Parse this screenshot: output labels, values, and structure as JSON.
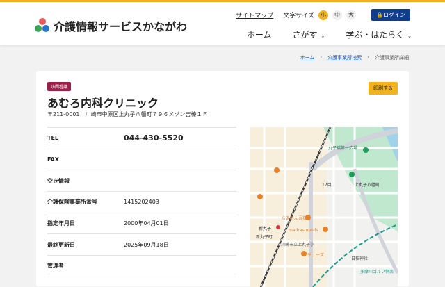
{
  "header": {
    "site_title": "介護情報サービスかながわ",
    "sitemap": "サイトマップ",
    "font_size_label": "文字サイズ",
    "sizes": [
      "小",
      "中",
      "大"
    ],
    "login": "ログイン"
  },
  "nav": [
    "ホーム",
    "さがす",
    "学ぶ・はたらく"
  ],
  "breadcrumb": [
    "ホーム",
    "介護事業所検索",
    "介護事業所詳細"
  ],
  "facility": {
    "category": "訪問看護",
    "name": "あむろ内科クリニック",
    "address": "〒211-0001　川崎市中原区上丸子八幡町７９６メゾン吉榛１Ｆ",
    "print": "印刷する"
  },
  "details": [
    {
      "label": "TEL",
      "value": "044-430-5520"
    },
    {
      "label": "FAX",
      "value": ""
    },
    {
      "label": "空き情報",
      "value": ""
    },
    {
      "label": "介護保険事業所番号",
      "value": "1415202403"
    },
    {
      "label": "指定年月日",
      "value": "2000年04月01日"
    },
    {
      "label": "最終更新日",
      "value": "2025年09月18日"
    },
    {
      "label": "管理者",
      "value": ""
    }
  ],
  "map": {
    "labels": [
      "丸子橋第一広場",
      "上丸子八幡町",
      "新丸子",
      "madras meals",
      "らあめん吾楼",
      "川崎市立上丸子小",
      "デニーズ",
      "日枝神社",
      "多摩川ゴルフ倶楽",
      "17目",
      "新丸子町"
    ]
  }
}
